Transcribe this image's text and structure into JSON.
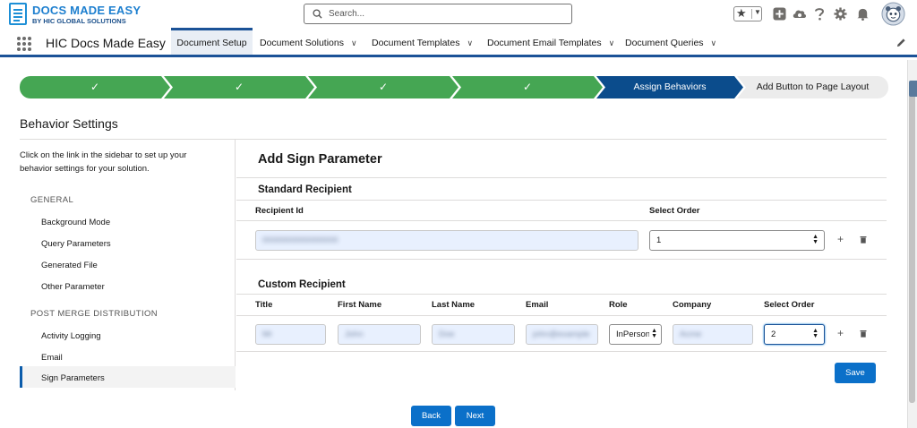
{
  "header": {
    "logo_title": "DOCS MADE EASY",
    "logo_subtitle": "BY HIC GLOBAL SOLUTIONS",
    "search_placeholder": "Search...",
    "favorites_star": "★",
    "icons": [
      "add-icon",
      "setup-cloud-icon",
      "help-icon",
      "settings-gear-icon",
      "notifications-bell-icon",
      "user-avatar"
    ]
  },
  "nav": {
    "app_name": "HIC Docs Made Easy",
    "tabs": [
      {
        "label": "Document Setup",
        "active": true,
        "dropdown": false
      },
      {
        "label": "Document Solutions",
        "active": false,
        "dropdown": true
      },
      {
        "label": "Document Templates",
        "active": false,
        "dropdown": true
      },
      {
        "label": "Document Email Templates",
        "active": false,
        "dropdown": true
      },
      {
        "label": "Document Queries",
        "active": false,
        "dropdown": true
      }
    ]
  },
  "path": {
    "steps": [
      {
        "label": "✓",
        "state": "done"
      },
      {
        "label": "✓",
        "state": "done"
      },
      {
        "label": "✓",
        "state": "done"
      },
      {
        "label": "✓",
        "state": "done"
      },
      {
        "label": "Assign Behaviors",
        "state": "current"
      },
      {
        "label": "Add Button to Page Layout",
        "state": "todo"
      }
    ]
  },
  "page": {
    "title": "Behavior Settings"
  },
  "sidebar": {
    "intro": "Click on the link in the sidebar to set up your behavior settings for your solution.",
    "groups": [
      {
        "heading": "GENERAL",
        "items": [
          "Background Mode",
          "Query Parameters",
          "Generated File",
          "Other Parameter"
        ]
      },
      {
        "heading": "POST MERGE DISTRIBUTION",
        "items": [
          "Activity Logging",
          "Email",
          "Sign Parameters"
        ]
      }
    ],
    "selected": "Sign Parameters"
  },
  "main": {
    "title": "Add Sign Parameter",
    "standard": {
      "heading": "Standard Recipient",
      "recipient_id_label": "Recipient Id",
      "select_order_label": "Select Order",
      "recipient_id_value": "0000000000000000",
      "select_order_value": "1"
    },
    "custom": {
      "heading": "Custom Recipient",
      "columns": [
        "Title",
        "First Name",
        "Last Name",
        "Email",
        "Role",
        "Company",
        "Select Order"
      ],
      "row": {
        "title": "Mr",
        "first_name": "John",
        "last_name": "Doe",
        "email": "john@example",
        "role": "InPerson",
        "company": "Acme",
        "select_order": "2"
      }
    },
    "actions": {
      "add_icon": "+",
      "delete_icon": "trash-icon"
    },
    "save_label": "Save"
  },
  "footer": {
    "back_label": "Back",
    "next_label": "Next"
  },
  "colors": {
    "brand": "#1b5297",
    "step_done": "#45a653",
    "step_current": "#0b4c8c",
    "button": "#0b70c9"
  }
}
